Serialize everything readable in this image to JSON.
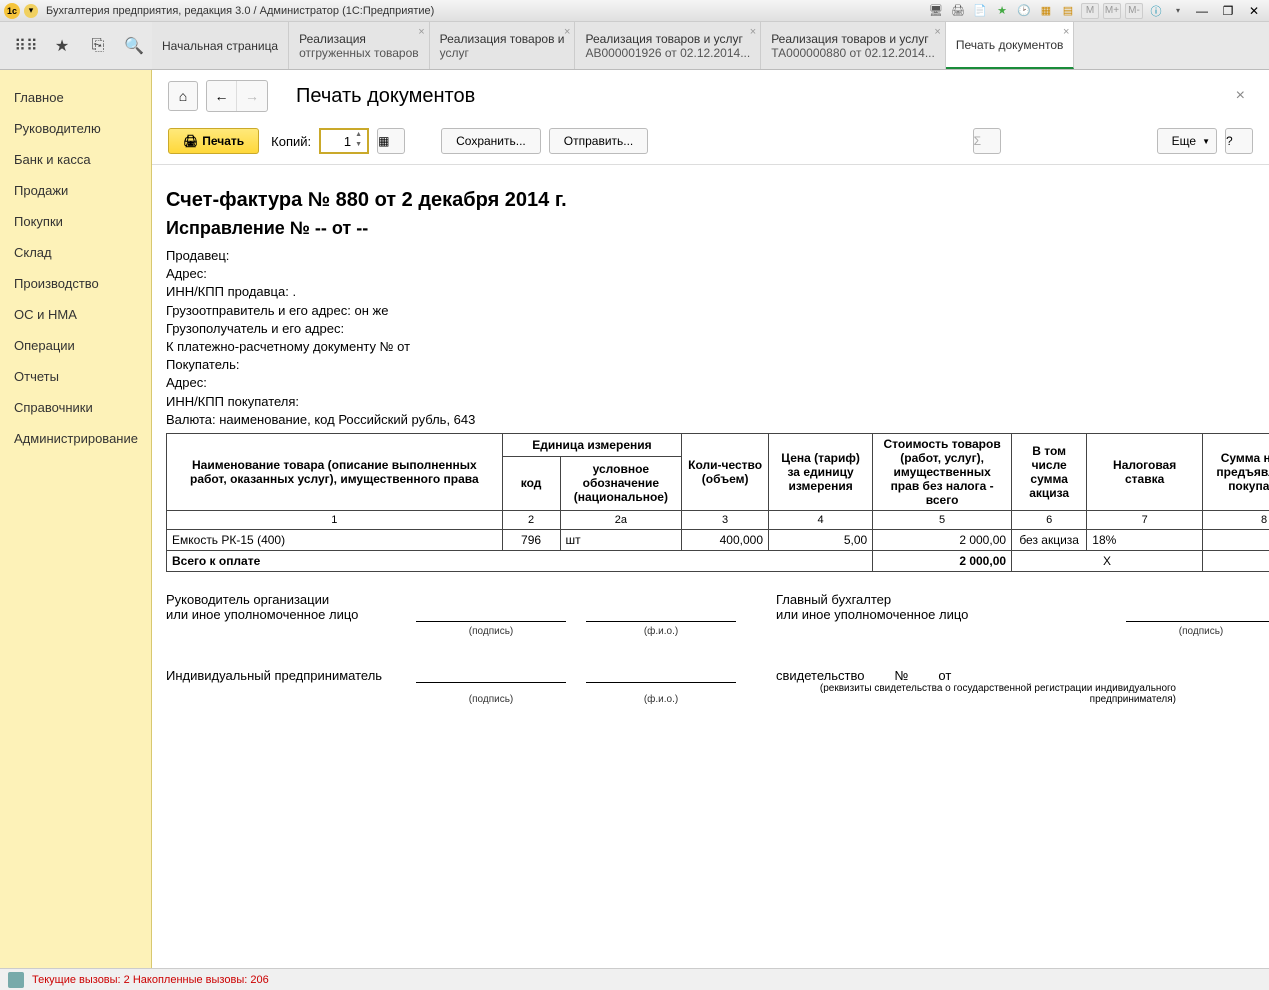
{
  "titlebar": {
    "text": "Бухгалтерия предприятия, редакция 3.0 / Администратор  (1С:Предприятие)",
    "m": "M",
    "mplus": "M+",
    "mminus": "M-"
  },
  "tabs": [
    {
      "l1": "Начальная страница",
      "l2": ""
    },
    {
      "l1": "Реализация",
      "l2": "отгруженных товаров"
    },
    {
      "l1": "Реализация товаров и",
      "l2": "услуг"
    },
    {
      "l1": "Реализация товаров и услуг",
      "l2": "АВ000001926 от 02.12.2014..."
    },
    {
      "l1": "Реализация товаров и услуг",
      "l2": "ТА000000880 от 02.12.2014..."
    },
    {
      "l1": "Печать документов",
      "l2": ""
    }
  ],
  "sidebar": [
    "Главное",
    "Руководителю",
    "Банк и касса",
    "Продажи",
    "Покупки",
    "Склад",
    "Производство",
    "ОС и НМА",
    "Операции",
    "Отчеты",
    "Справочники",
    "Администрирование"
  ],
  "page": {
    "title": "Печать документов",
    "print": "Печать",
    "copies_label": "Копий:",
    "copies_value": "1",
    "save": "Сохранить...",
    "send": "Отправить...",
    "more": "Еще",
    "help": "?"
  },
  "doc": {
    "h1": "Счет-фактура № 880 от 2 декабря 2014 г.",
    "h2": "Исправление № -- от --",
    "lines": [
      "Продавец:",
      "Адрес:",
      "ИНН/КПП продавца: .",
      "Грузоотправитель и его адрес: он же",
      "Грузополучатель и его адрес:",
      "К платежно-расчетному документу №    от",
      "Покупатель:",
      "Адрес:",
      "ИНН/КПП покупателя:",
      "Валюта: наименование, код Российский рубль, 643"
    ],
    "headers": {
      "c1": "Наименование товара (описание выполненных работ, оказанных услуг), имущественного права",
      "c2_top": "Единица измерения",
      "c2a": "код",
      "c2b": "условное обозначение (национальное)",
      "c3": "Коли-чество (объем)",
      "c4": "Цена (тариф) за единицу измерения",
      "c5": "Стоимость товаров (работ, услуг), имущественных прав без налога - всего",
      "c6": "В том числе сумма акциза",
      "c7": "Налоговая ставка",
      "c8": "Сумма налога, предъявляемая покупателю"
    },
    "nums": [
      "1",
      "2",
      "2а",
      "3",
      "4",
      "5",
      "6",
      "7",
      "8"
    ],
    "row": {
      "name": "Емкость РК-15 (400)",
      "code": "796",
      "unit": "шт",
      "qty": "400,000",
      "price": "5,00",
      "cost": "2 000,00",
      "excise": "без акциза",
      "rate": "18%",
      "tax": ""
    },
    "total_label": "Всего к оплате",
    "total_cost": "2 000,00",
    "total_x": "X",
    "sign": {
      "role1a": "Руководитель организации",
      "role1b": "или иное уполномоченное лицо",
      "role2a": "Главный бухгалтер",
      "role2b": "или иное уполномоченное лицо",
      "podpis": "(подпись)",
      "fio": "(ф.и.о.)",
      "ip": "Индивидуальный предприниматель",
      "svid": "свидетельство",
      "no": "№",
      "ot": "от",
      "rekv": "(реквизиты свидетельства о государственной регистрации индивидуального предпринимателя)"
    }
  },
  "status": {
    "text": "Текущие вызовы: 2  Накопленные вызовы: 206"
  }
}
